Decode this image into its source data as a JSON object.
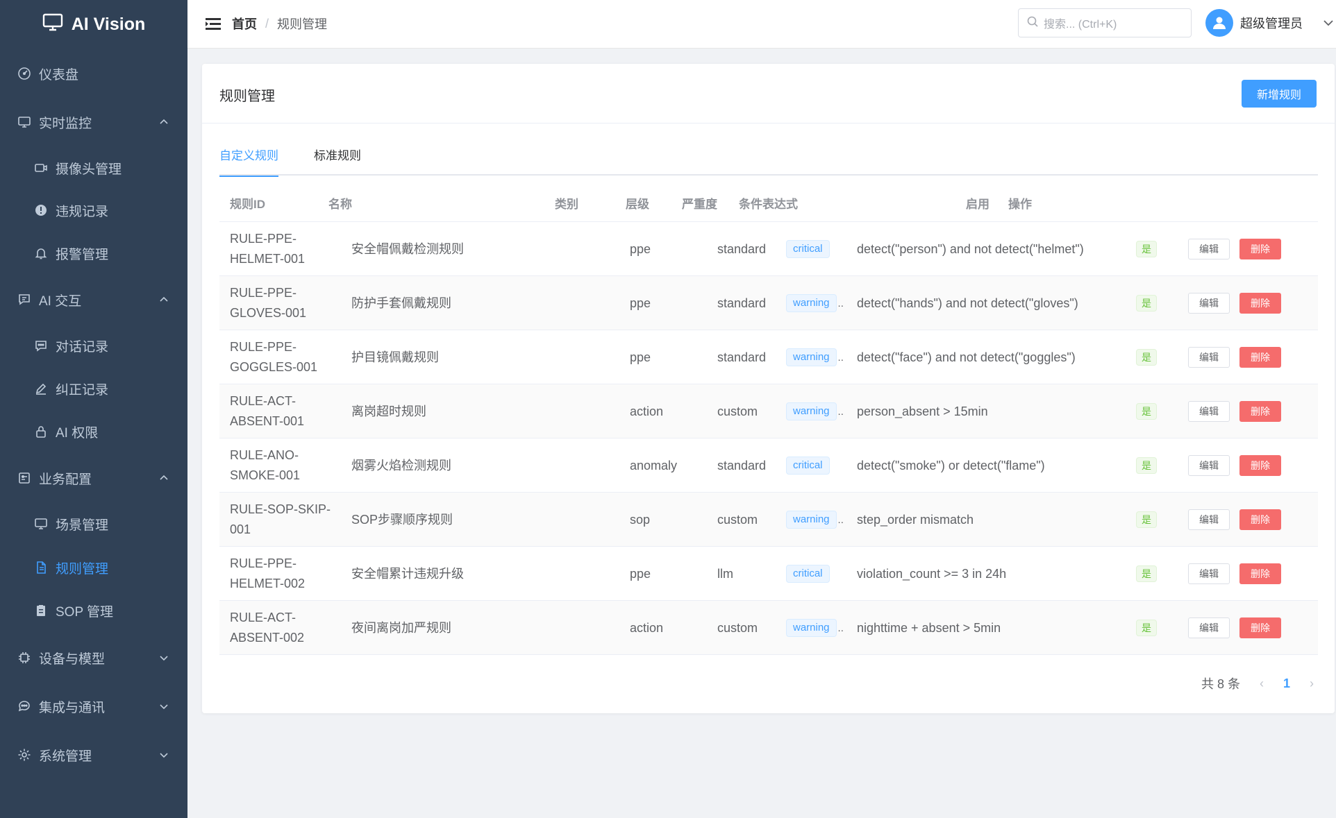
{
  "app": {
    "title": "AI Vision"
  },
  "sidebar": {
    "items": [
      {
        "label": "仪表盘",
        "icon": "gauge-icon",
        "level": "top"
      },
      {
        "label": "实时监控",
        "icon": "monitor-icon",
        "level": "top",
        "expanded": true
      },
      {
        "label": "摄像头管理",
        "icon": "camera-icon",
        "level": "sub"
      },
      {
        "label": "违规记录",
        "icon": "alert-circle-icon",
        "level": "sub"
      },
      {
        "label": "报警管理",
        "icon": "bell-icon",
        "level": "sub"
      },
      {
        "label": "AI 交互",
        "icon": "chat-icon",
        "level": "top",
        "expanded": true
      },
      {
        "label": "对话记录",
        "icon": "message-icon",
        "level": "sub"
      },
      {
        "label": "纠正记录",
        "icon": "edit-pen-icon",
        "level": "sub"
      },
      {
        "label": "AI 权限",
        "icon": "lock-icon",
        "level": "sub"
      },
      {
        "label": "业务配置",
        "icon": "config-icon",
        "level": "top",
        "expanded": true
      },
      {
        "label": "场景管理",
        "icon": "monitor-icon",
        "level": "sub"
      },
      {
        "label": "规则管理",
        "icon": "document-icon",
        "level": "sub",
        "active": true
      },
      {
        "label": "SOP 管理",
        "icon": "clipboard-icon",
        "level": "sub"
      },
      {
        "label": "设备与模型",
        "icon": "cpu-icon",
        "level": "top",
        "expanded": false
      },
      {
        "label": "集成与通讯",
        "icon": "chat-round-icon",
        "level": "top",
        "expanded": false
      },
      {
        "label": "系统管理",
        "icon": "gear-icon",
        "level": "top",
        "expanded": false
      }
    ]
  },
  "header": {
    "breadcrumb": {
      "home": "首页",
      "separator": "/",
      "current": "规则管理"
    },
    "search": {
      "placeholder": "搜索... (Ctrl+K)"
    },
    "user": {
      "name": "超级管理员"
    }
  },
  "page": {
    "title": "规则管理",
    "add_button": "新增规则",
    "tabs": [
      {
        "label": "自定义规则",
        "active": true
      },
      {
        "label": "标准规则",
        "active": false
      }
    ]
  },
  "table": {
    "columns": [
      "规则ID",
      "名称",
      "类别",
      "层级",
      "严重度",
      "条件表达式",
      "启用",
      "操作"
    ],
    "edit_label": "编辑",
    "delete_label": "删除",
    "rows": [
      {
        "id": "RULE-PPE-HELMET-001",
        "name": "安全帽佩戴检测规则",
        "category": "ppe",
        "level": "standard",
        "severity": "critical",
        "condition": "detect(\"person\") and not detect(\"helmet\")",
        "enabled": "是"
      },
      {
        "id": "RULE-PPE-GLOVES-001",
        "name": "防护手套佩戴规则",
        "category": "ppe",
        "level": "standard",
        "severity": "warning",
        "condition": "detect(\"hands\") and not detect(\"gloves\")",
        "enabled": "是"
      },
      {
        "id": "RULE-PPE-GOGGLES-001",
        "name": "护目镜佩戴规则",
        "category": "ppe",
        "level": "standard",
        "severity": "warning",
        "condition": "detect(\"face\") and not detect(\"goggles\")",
        "enabled": "是"
      },
      {
        "id": "RULE-ACT-ABSENT-001",
        "name": "离岗超时规则",
        "category": "action",
        "level": "custom",
        "severity": "warning",
        "condition": "person_absent > 15min",
        "enabled": "是"
      },
      {
        "id": "RULE-ANO-SMOKE-001",
        "name": "烟雾火焰检测规则",
        "category": "anomaly",
        "level": "standard",
        "severity": "critical",
        "condition": "detect(\"smoke\") or detect(\"flame\")",
        "enabled": "是"
      },
      {
        "id": "RULE-SOP-SKIP-001",
        "name": "SOP步骤顺序规则",
        "category": "sop",
        "level": "custom",
        "severity": "warning",
        "condition": "step_order mismatch",
        "enabled": "是"
      },
      {
        "id": "RULE-PPE-HELMET-002",
        "name": "安全帽累计违规升级",
        "category": "ppe",
        "level": "llm",
        "severity": "critical",
        "condition": "violation_count >= 3 in 24h",
        "enabled": "是"
      },
      {
        "id": "RULE-ACT-ABSENT-002",
        "name": "夜间离岗加严规则",
        "category": "action",
        "level": "custom",
        "severity": "warning",
        "condition": "nighttime + absent > 5min",
        "enabled": "是"
      }
    ]
  },
  "pagination": {
    "total_text": "共 8 条",
    "current_page": "1",
    "prev": "‹",
    "next": "›"
  },
  "colors": {
    "sidebar_bg": "#304156",
    "primary": "#409eff",
    "danger": "#f56c6c",
    "success": "#67c23a"
  }
}
